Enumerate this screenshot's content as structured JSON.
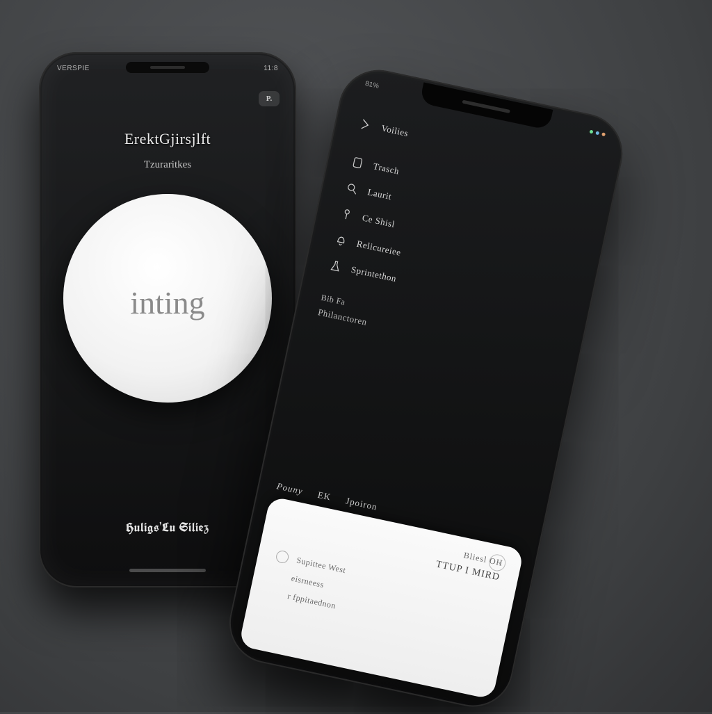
{
  "phone_left": {
    "status_left": "VERSPIE",
    "status_right": "11:8",
    "corner_badge": "P.",
    "title": "ErektGjirsjlft",
    "subtitle": "Tzuraritkes",
    "circle_label": "inting",
    "footer": "Huligs'Lu Siliez"
  },
  "phone_right": {
    "status_left": "81%",
    "header": "Voilies",
    "menu": [
      {
        "icon": "tablet-icon",
        "label": "Trasch"
      },
      {
        "icon": "search-icon",
        "label": "Laurit"
      },
      {
        "icon": "accessory-icon",
        "label": "Ce Shisl"
      },
      {
        "icon": "bell-icon",
        "label": "Relicureiee"
      },
      {
        "icon": "flask-icon",
        "label": "Sprintethon"
      }
    ],
    "section_small": "Bib Fa",
    "section_strong": "Philanctoren",
    "bottom_left": "Pouny",
    "bottom_meta_a": "EK",
    "bottom_meta_b": "Jpoiron",
    "card": {
      "head": "Bliesl OH",
      "title": "TTUP I MIRD",
      "row1": "Supittee West",
      "row2": "eisrneess",
      "row3": "r fppitaednon"
    }
  }
}
